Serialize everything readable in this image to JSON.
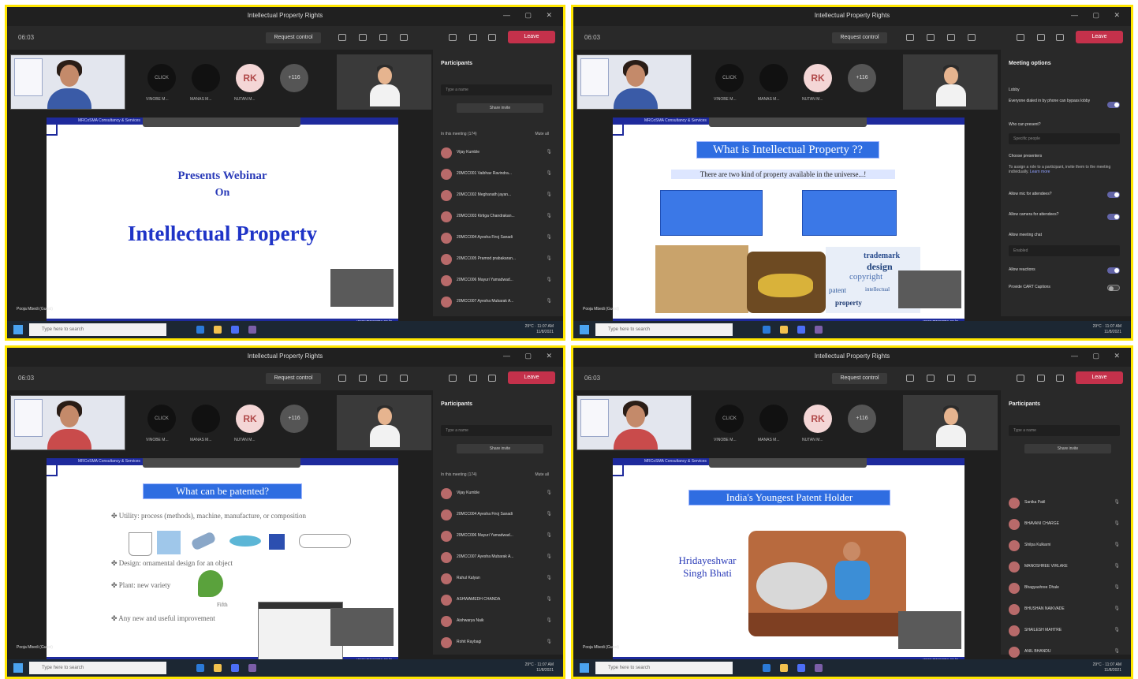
{
  "app": {
    "window_title": "Intellectual Property Rights",
    "request_control": "Request control",
    "leave": "Leave",
    "clock": "06:03"
  },
  "video": {
    "avatar_rk": "RK",
    "more_count": "+116",
    "names": [
      "VINOBE M...",
      "MANAS M...",
      "NUTAN M..."
    ]
  },
  "participants": {
    "title": "Participants",
    "search_placeholder": "Type a name",
    "share_invite": "Share invite",
    "in_meeting": "In this meeting (174)",
    "mute_all": "Mute all",
    "q1_list": [
      "Vijay Kumble",
      "20MCC001 Vaibhav Ravindra...",
      "20MCC002 Meghanath jayan...",
      "20MCC003 Kirtiga Chandrakan...",
      "20MCC004 Ayesha Firoj Sanadi",
      "20MCC005 Pramod prabakaran...",
      "20MCC006 Mayuri Yamadwad...",
      "20MCC007 Ayesha Mubarak A..."
    ],
    "q3_list": [
      "Vijay Kumble",
      "20MCC004 Ayesha Firoj Sanadi",
      "20MCC006 Mayuri Yamadwad...",
      "20MCC007 Ayesha Mubarak A...",
      "Rahul Kalyan",
      "ASHWAMEDH CHANDA",
      "Aishwarya Naik",
      "Rohit Raybagi"
    ],
    "q4_list": [
      "Sanika Patil",
      "BHAVANI CHARGE",
      "Shilpa Kulkarni",
      "MANOSHREE VIRLAKE",
      "Bhagyashree Dhale",
      "BHUSHAN NAIKVADE",
      "SHAILESH MAHTRE",
      "ANIL BHANDU"
    ]
  },
  "meeting_options": {
    "title": "Meeting options",
    "lobby": "Lobby",
    "opt_dialin": "Everyone dialed in by phone can bypass lobby",
    "who_present": "Who can present?",
    "specific_people": "Specific people",
    "choose_presenters": "Choose presenters",
    "assign_text": "To assign a role to a participant, invite them to the meeting individually.",
    "learn_more": "Learn more",
    "allow_mic": "Allow mic for attendees?",
    "allow_camera": "Allow camera for attendees?",
    "allow_chat": "Allow meeting chat",
    "enabled": "Enabled",
    "allow_reactions": "Allow reactions",
    "captions": "Provide CART Captions"
  },
  "slides": {
    "presents": "Presents Webinar",
    "on": "On",
    "ip": "Intellectual Property",
    "what_is_ip": "What is Intellectual Property ??",
    "two_kinds": "There are two kind of property available in the universe...!",
    "what_patented": "What can be patented?",
    "b1": "Utility: process (methods), machine, manufacture, or composition",
    "b2": "Design: ornamental design for an object",
    "b3": "Plant: new variety",
    "b4": "Any new and useful improvement",
    "plant_label": "Fifth",
    "youngest": "India's Youngest Patent Holder",
    "holder_name": "Hridayeshwar Singh Bhati",
    "topline": "MRCoSMA Consultancy & Services",
    "footer": "www.mrcosma.co.in",
    "presenter": "Pooja Mbedi (Guest)",
    "wordcloud": [
      "trademark",
      "design",
      "copyright",
      "patent",
      "intellectual",
      "property"
    ]
  },
  "taskbar": {
    "search": "Type here to search",
    "weather": "29°C",
    "time": "11:07 AM",
    "date": "11/8/2021"
  },
  "colors": {
    "frame": "#ffe600",
    "leave": "#c4314b",
    "slide_blue": "#1e2a9c",
    "accent": "#6264a7"
  }
}
